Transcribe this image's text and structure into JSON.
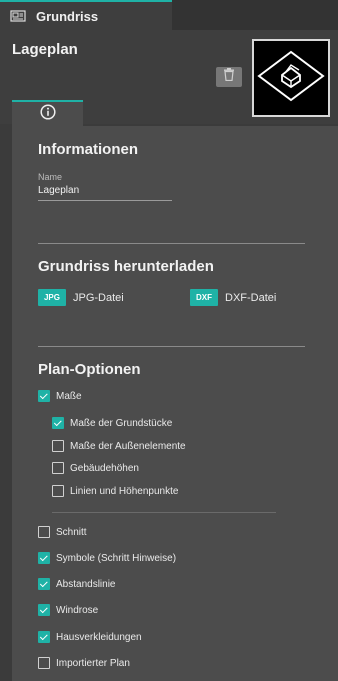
{
  "tabs": {
    "main": "Grundriss"
  },
  "header": {
    "title": "Lageplan"
  },
  "info_tab": {
    "icon": "info-icon"
  },
  "informationen": {
    "title": "Informationen",
    "name_label": "Name",
    "name_value": "Lageplan"
  },
  "download": {
    "title": "Grundriss herunterladen",
    "jpg_badge": "JPG",
    "jpg_label": "JPG-Datei",
    "dxf_badge": "DXF",
    "dxf_label": "DXF-Datei"
  },
  "plan_options": {
    "title": "Plan-Optionen",
    "items": [
      {
        "label": "Maße",
        "checked": true
      },
      {
        "label": "Maße der Grundstücke",
        "checked": true
      },
      {
        "label": "Maße der Außenelemente",
        "checked": false
      },
      {
        "label": "Gebäudehöhen",
        "checked": false
      },
      {
        "label": "Linien und Höhenpunkte",
        "checked": false
      },
      {
        "label": "Schnitt",
        "checked": false
      },
      {
        "label": "Symbole (Schritt Hinweise)",
        "checked": true
      },
      {
        "label": "Abstandslinie",
        "checked": true
      },
      {
        "label": "Windrose",
        "checked": true
      },
      {
        "label": "Hausverkleidungen",
        "checked": true
      },
      {
        "label": "Importierter Plan",
        "checked": false
      }
    ]
  },
  "colors": {
    "accent": "#1fb2a6",
    "background": "#3b3b3b",
    "panel": "#4c4c4c"
  }
}
